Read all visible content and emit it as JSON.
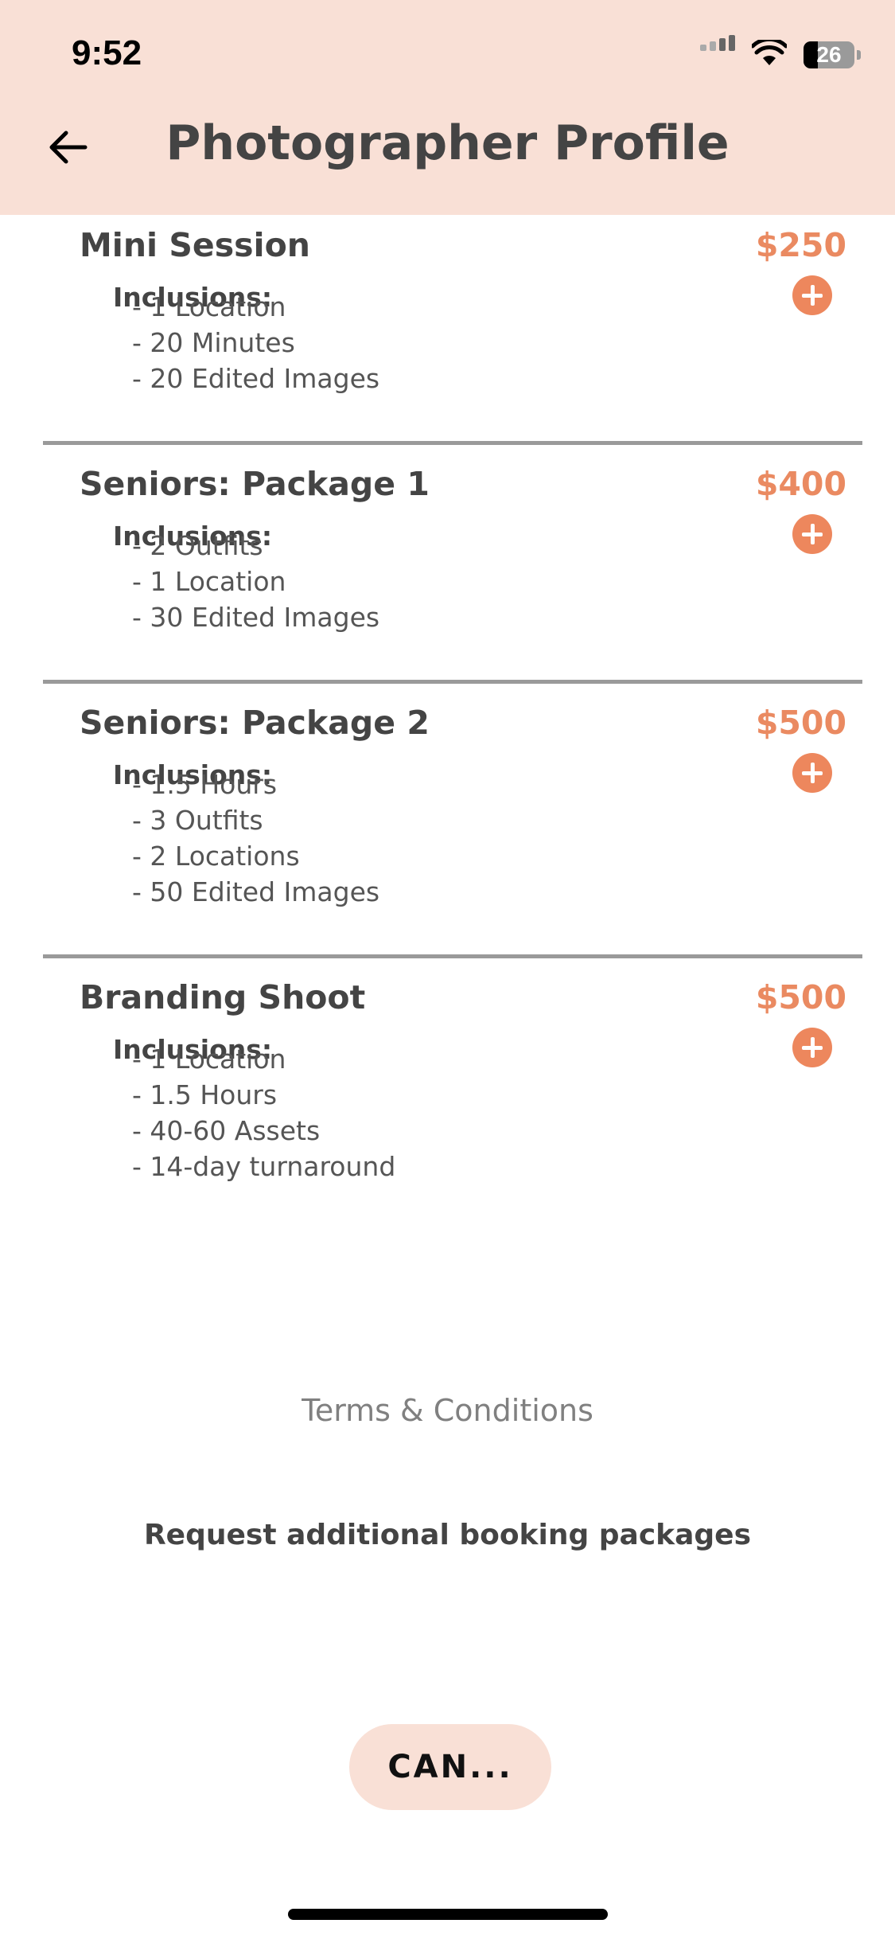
{
  "status_bar": {
    "time": "9:52",
    "battery": "26"
  },
  "header": {
    "title": "Photographer Profile",
    "back_icon": "arrow-left-icon",
    "background": "#f9e0d6"
  },
  "packages": [
    {
      "name": "Mini Session",
      "price": "$250",
      "inclusions_label": "Inclusions:",
      "inclusions": [
        "- 1 Location",
        "- 20 Minutes",
        "- 20 Edited Images"
      ]
    },
    {
      "name": "Seniors: Package 1",
      "price": "$400",
      "inclusions_label": "Inclusions:",
      "inclusions": [
        "- 2 Outfits",
        "- 1 Location",
        "- 30 Edited Images"
      ]
    },
    {
      "name": "Seniors: Package 2",
      "price": "$500",
      "inclusions_label": "Inclusions:",
      "inclusions": [
        "- 1.5 Hours",
        "- 3 Outfits",
        "- 2 Locations",
        "- 50 Edited Images"
      ]
    },
    {
      "name": "Branding Shoot",
      "price": "$500",
      "inclusions_label": "Inclusions:",
      "inclusions": [
        "- 1 Location",
        "- 1.5 Hours",
        "- 40-60 Assets",
        "- 14-day turnaround"
      ]
    }
  ],
  "footer": {
    "terms_link": "Terms & Conditions",
    "request_link": "Request additional booking packages",
    "cancel_button": "CAN..."
  },
  "colors": {
    "accent": "#ed875d",
    "price": "#ea8a61",
    "divider": "#9a9a9a"
  }
}
